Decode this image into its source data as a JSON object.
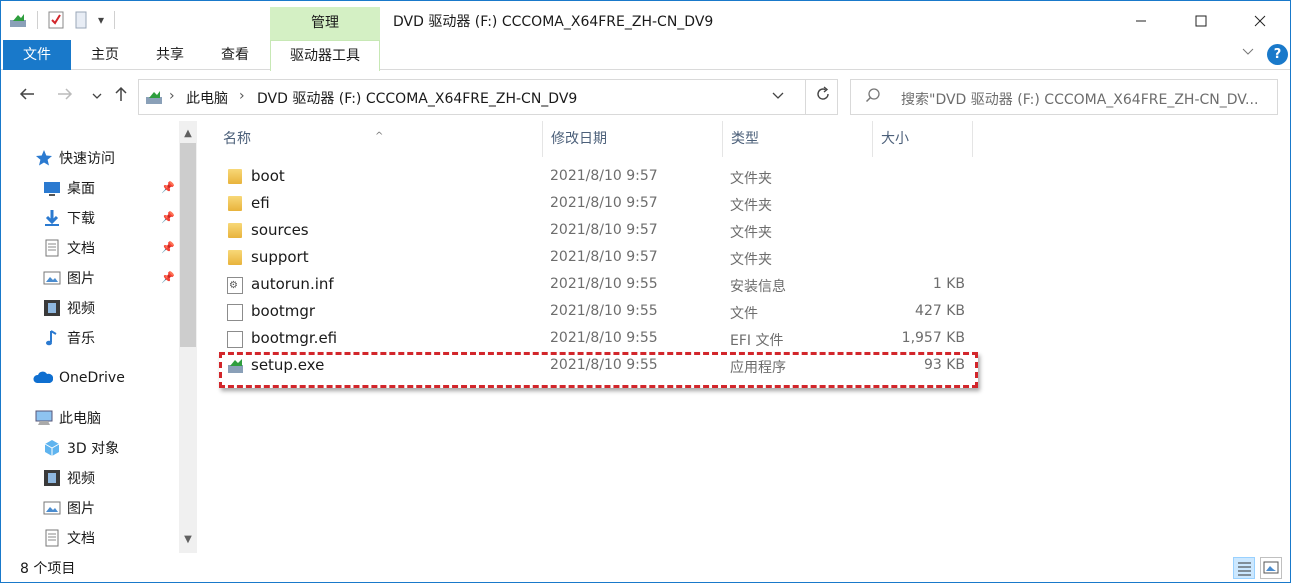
{
  "titlebar": {
    "manage_tab": "管理",
    "title": "DVD 驱动器 (F:) CCCOMA_X64FRE_ZH-CN_DV9",
    "qat_dropdown": "▾"
  },
  "ribbon": {
    "tabs": [
      "文件",
      "主页",
      "共享",
      "查看",
      "驱动器工具"
    ],
    "help": "?"
  },
  "address": {
    "breadcrumb": [
      "此电脑",
      "DVD 驱动器 (F:) CCCOMA_X64FRE_ZH-CN_DV9"
    ],
    "search_placeholder": "搜索\"DVD 驱动器 (F:) CCCOMA_X64FRE_ZH-CN_DV..."
  },
  "nav": {
    "quick_access": "快速访问",
    "quick_items": [
      "桌面",
      "下载",
      "文档",
      "图片",
      "视频",
      "音乐"
    ],
    "onedrive": "OneDrive",
    "this_pc": "此电脑",
    "pc_items": [
      "3D 对象",
      "视频",
      "图片",
      "文档"
    ]
  },
  "columns": {
    "name": "名称",
    "date": "修改日期",
    "type": "类型",
    "size": "大小"
  },
  "files": [
    {
      "name": "boot",
      "date": "2021/8/10 9:57",
      "type": "文件夹",
      "size": "",
      "icon": "folder-icon"
    },
    {
      "name": "efi",
      "date": "2021/8/10 9:57",
      "type": "文件夹",
      "size": "",
      "icon": "folder-icon"
    },
    {
      "name": "sources",
      "date": "2021/8/10 9:57",
      "type": "文件夹",
      "size": "",
      "icon": "folder-icon"
    },
    {
      "name": "support",
      "date": "2021/8/10 9:57",
      "type": "文件夹",
      "size": "",
      "icon": "folder-icon"
    },
    {
      "name": "autorun.inf",
      "date": "2021/8/10 9:55",
      "type": "安装信息",
      "size": "1 KB",
      "icon": "setup-info-icon"
    },
    {
      "name": "bootmgr",
      "date": "2021/8/10 9:55",
      "type": "文件",
      "size": "427 KB",
      "icon": "file-icon"
    },
    {
      "name": "bootmgr.efi",
      "date": "2021/8/10 9:55",
      "type": "EFI 文件",
      "size": "1,957 KB",
      "icon": "file-icon"
    },
    {
      "name": "setup.exe",
      "date": "2021/8/10 9:55",
      "type": "应用程序",
      "size": "93 KB",
      "icon": "setup-exe-icon"
    }
  ],
  "status": {
    "count": "8 个项目"
  },
  "colors": {
    "accent": "#1979ca",
    "manage_tab_bg": "#d4f0c4",
    "highlight": "#d2262b"
  }
}
